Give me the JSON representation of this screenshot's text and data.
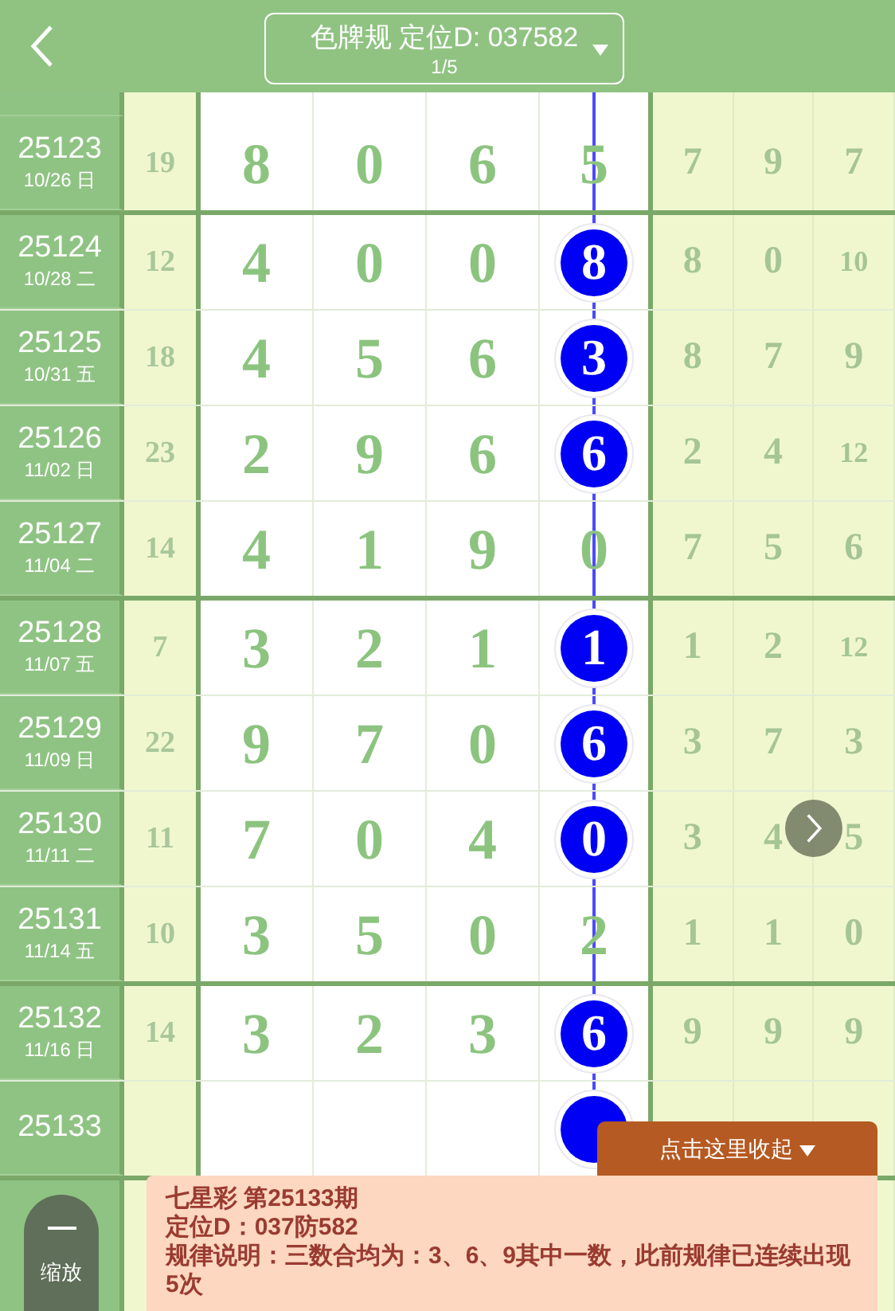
{
  "header": {
    "title": "色牌规 定位D: 037582",
    "subtitle": "1/5"
  },
  "groups": [
    {
      "rows": [
        {
          "period": "25123",
          "date": "10/26 日",
          "sum": "19",
          "digits": [
            "8",
            "0",
            "6"
          ],
          "d": {
            "value": "5",
            "hit": false
          },
          "tail": [
            "7",
            "9",
            "7"
          ]
        }
      ]
    },
    {
      "rows": [
        {
          "period": "25124",
          "date": "10/28 二",
          "sum": "12",
          "digits": [
            "4",
            "0",
            "0"
          ],
          "d": {
            "value": "8",
            "hit": true
          },
          "tail": [
            "8",
            "0",
            "10"
          ]
        },
        {
          "period": "25125",
          "date": "10/31 五",
          "sum": "18",
          "digits": [
            "4",
            "5",
            "6"
          ],
          "d": {
            "value": "3",
            "hit": true
          },
          "tail": [
            "8",
            "7",
            "9"
          ]
        },
        {
          "period": "25126",
          "date": "11/02 日",
          "sum": "23",
          "digits": [
            "2",
            "9",
            "6"
          ],
          "d": {
            "value": "6",
            "hit": true
          },
          "tail": [
            "2",
            "4",
            "12"
          ]
        },
        {
          "period": "25127",
          "date": "11/04 二",
          "sum": "14",
          "digits": [
            "4",
            "1",
            "9"
          ],
          "d": {
            "value": "0",
            "hit": false
          },
          "tail": [
            "7",
            "5",
            "6"
          ]
        }
      ]
    },
    {
      "rows": [
        {
          "period": "25128",
          "date": "11/07 五",
          "sum": "7",
          "digits": [
            "3",
            "2",
            "1"
          ],
          "d": {
            "value": "1",
            "hit": true
          },
          "tail": [
            "1",
            "2",
            "12"
          ]
        },
        {
          "period": "25129",
          "date": "11/09 日",
          "sum": "22",
          "digits": [
            "9",
            "7",
            "0"
          ],
          "d": {
            "value": "6",
            "hit": true
          },
          "tail": [
            "3",
            "7",
            "3"
          ]
        },
        {
          "period": "25130",
          "date": "11/11 二",
          "sum": "11",
          "digits": [
            "7",
            "0",
            "4"
          ],
          "d": {
            "value": "0",
            "hit": true
          },
          "tail": [
            "3",
            "4",
            "5"
          ]
        },
        {
          "period": "25131",
          "date": "11/14 五",
          "sum": "10",
          "digits": [
            "3",
            "5",
            "0"
          ],
          "d": {
            "value": "2",
            "hit": false
          },
          "tail": [
            "1",
            "1",
            "0"
          ]
        }
      ]
    },
    {
      "rows": [
        {
          "period": "25132",
          "date": "11/16 日",
          "sum": "14",
          "digits": [
            "3",
            "2",
            "3"
          ],
          "d": {
            "value": "6",
            "hit": true
          },
          "tail": [
            "9",
            "9",
            "9"
          ]
        },
        {
          "period": "25133",
          "digits": [],
          "d": {
            "hit": true
          },
          "tail": []
        }
      ]
    }
  ],
  "zoom_button": {
    "label": "缩放"
  },
  "panel": {
    "toggle": "点击这里收起",
    "lines": [
      "七星彩 第25133期",
      "定位D：037防582",
      "规律说明：三数合均为：3、6、9其中一数，此前规律已连续出现5次"
    ]
  }
}
